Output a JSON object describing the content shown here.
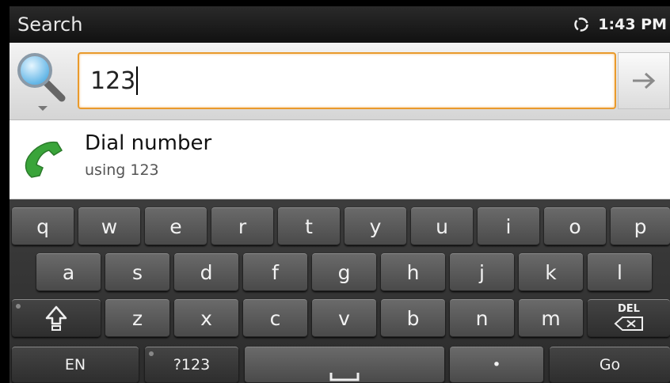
{
  "status_bar": {
    "title": "Search",
    "time": "1:43 PM",
    "sync_icon": "sync-icon"
  },
  "search": {
    "query": "123",
    "go_icon": "arrow-right-icon",
    "source_icon": "magnifier-icon"
  },
  "suggestion": {
    "title": "Dial number",
    "subtitle": "using 123",
    "icon": "phone-icon",
    "icon_color": "#3aa43a"
  },
  "keyboard": {
    "row1": [
      "q",
      "w",
      "e",
      "r",
      "t",
      "y",
      "u",
      "i",
      "o",
      "p"
    ],
    "row2": [
      "a",
      "s",
      "d",
      "f",
      "g",
      "h",
      "j",
      "k",
      "l"
    ],
    "row3": [
      "z",
      "x",
      "c",
      "v",
      "b",
      "n",
      "m"
    ],
    "del_label": "DEL",
    "lang_label": "EN",
    "symbols_label": "?123",
    "period_label": "•",
    "go_label": "Go"
  },
  "colors": {
    "focus_border": "#e99a2c",
    "key_bg": "#5a5a5a",
    "keyboard_bg": "#333333"
  }
}
